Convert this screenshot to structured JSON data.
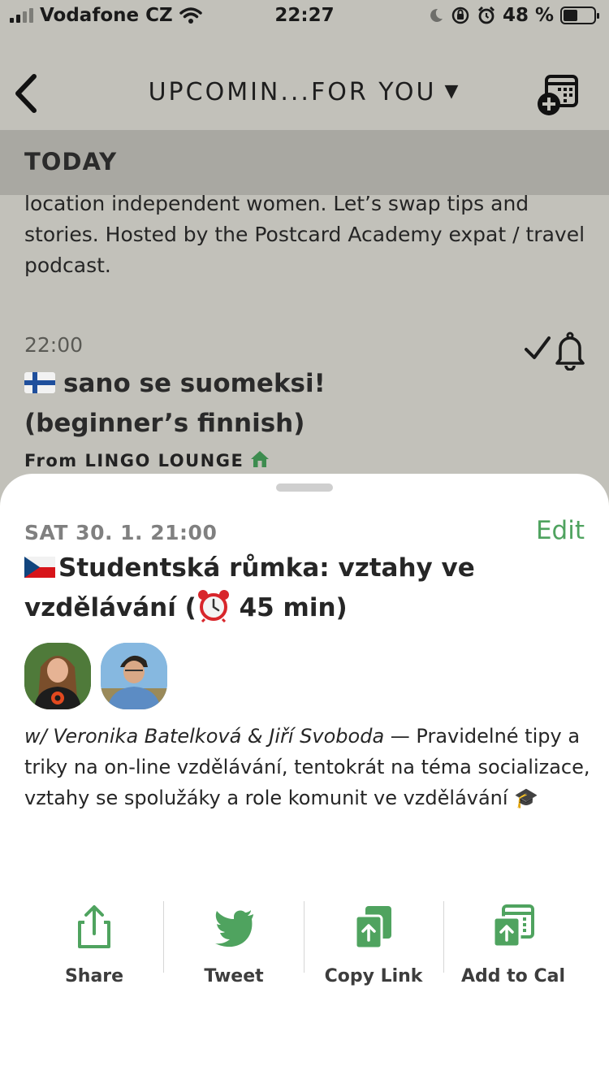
{
  "status_bar": {
    "carrier": "Vodafone CZ",
    "time": "22:27",
    "battery": "48 %",
    "battery_level": 0.48
  },
  "nav": {
    "title": "UPCOMIN...FOR YOU",
    "caret": "▼"
  },
  "background": {
    "section_header": "TODAY",
    "description_tail": "location independent women. Let’s swap tips and stories. Hosted by the Postcard Academy expat / travel podcast.",
    "event_time": "22:00",
    "event_title_line1": "sano se suomeksi!",
    "event_title_line2": "(beginner’s finnish)",
    "event_club": "From LINGO LOUNGE"
  },
  "sheet": {
    "datetime": "SAT 30. 1. 21:00",
    "edit_label": "Edit",
    "title_part1": "Studentská růmka: vztahy ve vzdělávání (",
    "title_part2": " 45 min)",
    "hosts": "w/ Veronika Batelková & Jiří Svoboda",
    "description": " — Pravidelné tipy a triky na on-line vzdělávání, tentokrát na téma socializace, vztahy se spolužáky a role komunit ve vzdělávání ",
    "description_emoji": "🎓",
    "actions": [
      {
        "label": "Share",
        "icon": "share-icon"
      },
      {
        "label": "Tweet",
        "icon": "twitter-icon"
      },
      {
        "label": "Copy Link",
        "icon": "copy-link-icon"
      },
      {
        "label": "Add to Cal",
        "icon": "add-to-calendar-icon"
      }
    ]
  },
  "colors": {
    "accent_green": "#4fa35f",
    "dim_background": "#c2c1ba",
    "section_header_bg": "#a9a8a2"
  }
}
